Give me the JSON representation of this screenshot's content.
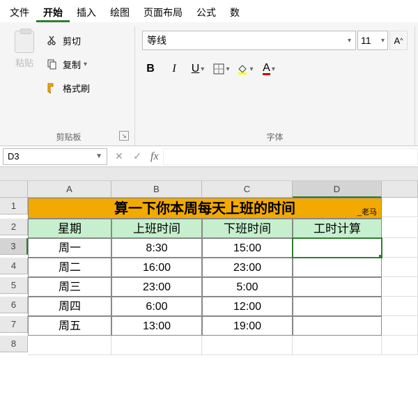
{
  "tabs": {
    "file": "文件",
    "home": "开始",
    "insert": "插入",
    "draw": "绘图",
    "layout": "页面布局",
    "formula": "公式",
    "data": "数"
  },
  "clipboard": {
    "paste": "粘贴",
    "cut": "剪切",
    "copy": "复制",
    "format_painter": "格式刷",
    "group_label": "剪贴板"
  },
  "font": {
    "name": "等线",
    "size": "11",
    "group_label": "字体",
    "bold": "B",
    "italic": "I",
    "underline": "U",
    "color_letter": "A"
  },
  "namebox": "D3",
  "formula": "",
  "fx_label": "fx",
  "columns": [
    "A",
    "B",
    "C",
    "D"
  ],
  "rows": [
    "1",
    "2",
    "3",
    "4",
    "5",
    "6",
    "7",
    "8"
  ],
  "sheet": {
    "title": "算一下你本周每天上班的时间",
    "title_sub": "_老马",
    "headers": {
      "c0": "星期",
      "c1": "上班时间",
      "c2": "下班时间",
      "c3": "工时计算"
    },
    "data": [
      {
        "day": "周一",
        "start": "8:30",
        "end": "15:00"
      },
      {
        "day": "周二",
        "start": "16:00",
        "end": "23:00"
      },
      {
        "day": "周三",
        "start": "23:00",
        "end": "5:00"
      },
      {
        "day": "周四",
        "start": "6:00",
        "end": "12:00"
      },
      {
        "day": "周五",
        "start": "13:00",
        "end": "19:00"
      }
    ]
  },
  "selected_cell": "D3",
  "chart_data": {
    "type": "table",
    "title": "算一下你本周每天上班的时间",
    "columns": [
      "星期",
      "上班时间",
      "下班时间",
      "工时计算"
    ],
    "rows": [
      [
        "周一",
        "8:30",
        "15:00",
        ""
      ],
      [
        "周二",
        "16:00",
        "23:00",
        ""
      ],
      [
        "周三",
        "23:00",
        "5:00",
        ""
      ],
      [
        "周四",
        "6:00",
        "12:00",
        ""
      ],
      [
        "周五",
        "13:00",
        "19:00",
        ""
      ]
    ]
  }
}
